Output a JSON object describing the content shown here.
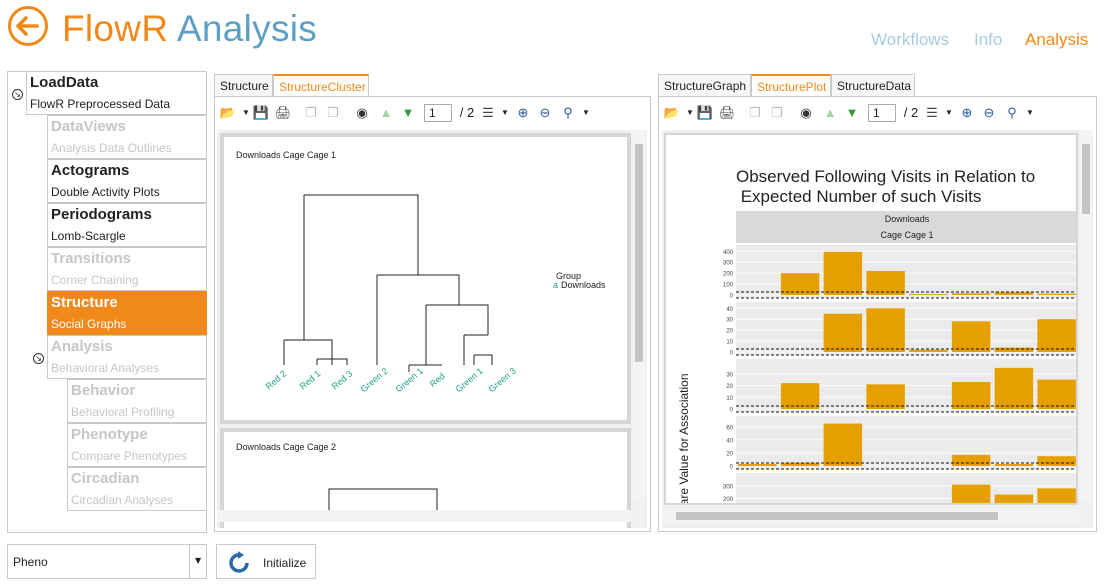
{
  "header": {
    "title_part1": "FlowR",
    "title_part2": "Analysis",
    "nav": [
      "Workflows",
      "Info",
      "Analysis"
    ]
  },
  "colors": {
    "accent": "#f0891a",
    "blue": "#5e9fc4",
    "nav_inactive": "#a7cbe0",
    "bar": "#e69f00"
  },
  "sidebar": {
    "items": [
      {
        "title": "LoadData",
        "subtitle": "FlowR Preprocessed Data",
        "state": "normal"
      },
      {
        "title": "DataViews",
        "subtitle": "Analysis Data Outlines",
        "state": "disabled"
      },
      {
        "title": "Actograms",
        "subtitle": "Double Activity Plots",
        "state": "normal"
      },
      {
        "title": "Periodograms",
        "subtitle": "Lomb-Scargle",
        "state": "normal"
      },
      {
        "title": "Transitions",
        "subtitle": "Corner Chaining",
        "state": "disabled"
      },
      {
        "title": "Structure",
        "subtitle": "Social Graphs",
        "state": "active"
      },
      {
        "title": "Analysis",
        "subtitle": "Behavioral Analyses",
        "state": "disabled"
      },
      {
        "title": "Behavior",
        "subtitle": "Behavioral Profiling",
        "state": "disabled"
      },
      {
        "title": "Phenotype",
        "subtitle": "Compare Phenotypes",
        "state": "disabled"
      },
      {
        "title": "Circadian",
        "subtitle": "Circadian Analyses",
        "state": "disabled"
      }
    ]
  },
  "left_panel": {
    "tabs": [
      "Structure",
      "StructureCluster"
    ],
    "selected_tab": "StructureCluster",
    "page": "1",
    "page_total": "/ 2",
    "page1_title": "Downloads Cage Cage 1",
    "page2_title": "Downloads Cage Cage 2",
    "legend_title": "Group",
    "legend_item": "Downloads",
    "leaves": [
      "Red 2",
      "Red 1",
      "Red 3",
      "Green 2",
      "Green 1",
      "Red",
      "Green 1",
      "Green 3"
    ]
  },
  "right_panel": {
    "tabs": [
      "StructureGraph",
      "StructurePlot",
      "StructureData"
    ],
    "selected_tab": "StructurePlot",
    "page": "1",
    "page_total": "/ 2",
    "chart_title_line1": "Observed Following Visits in Relation to",
    "chart_title_line2": " Expected Number of such Visits",
    "strip1": "Downloads",
    "strip2": "Cage Cage 1",
    "ylabel": "uare Value for Association"
  },
  "chart_data": {
    "type": "bar",
    "title": "Observed Following Visits in Relation to Expected Number of such Visits",
    "facets": [
      "Downloads",
      "Cage Cage 1"
    ],
    "ylabel": "uare Value for Association",
    "panels": [
      {
        "yticks": [
          0,
          100,
          200,
          300,
          400
        ],
        "ylim": [
          0,
          430
        ],
        "values": [
          0,
          200,
          395,
          220,
          8,
          15,
          25,
          12
        ]
      },
      {
        "yticks": [
          0,
          10,
          20,
          30,
          40
        ],
        "ylim": [
          0,
          43
        ],
        "values": [
          0,
          0,
          35,
          40,
          2,
          28,
          4,
          30
        ]
      },
      {
        "yticks": [
          0,
          10,
          20,
          30
        ],
        "ylim": [
          0,
          40
        ],
        "values": [
          0,
          22,
          0,
          21,
          0,
          23,
          35,
          25
        ]
      },
      {
        "yticks": [
          0,
          20,
          40,
          60
        ],
        "ylim": [
          0,
          72
        ],
        "values": [
          3,
          5,
          65,
          0,
          0,
          17,
          3,
          15
        ]
      },
      {
        "yticks": [
          200,
          300
        ],
        "ylim": [
          0,
          380
        ],
        "values": [
          0,
          0,
          0,
          0,
          0,
          310,
          230,
          280
        ]
      }
    ]
  },
  "bottom": {
    "pheno_value": "Pheno",
    "init_label": "Initialize"
  }
}
